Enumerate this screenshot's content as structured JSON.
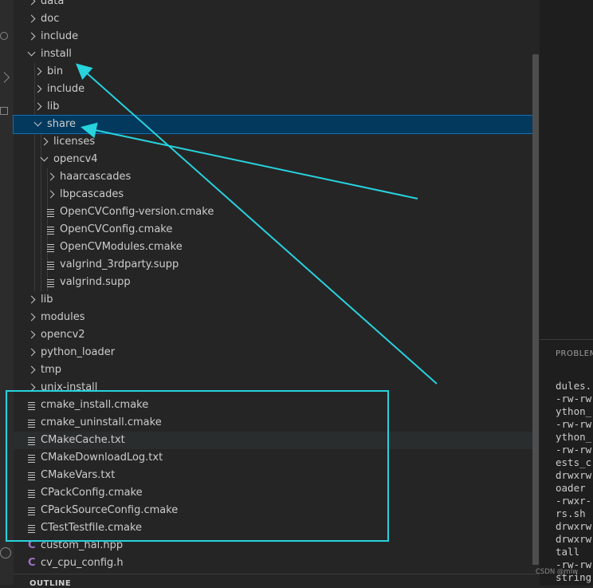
{
  "explorer": {
    "rows": [
      {
        "label": "data",
        "icon": "chevron-right"
      },
      {
        "label": "doc",
        "icon": "chevron-right"
      },
      {
        "label": "include",
        "icon": "chevron-right"
      },
      {
        "label": "install",
        "icon": "chevron-down"
      },
      {
        "label": "bin",
        "icon": "chevron-right"
      },
      {
        "label": "include",
        "icon": "chevron-right"
      },
      {
        "label": "lib",
        "icon": "chevron-right"
      },
      {
        "label": "share",
        "icon": "chevron-down"
      },
      {
        "label": "licenses",
        "icon": "chevron-right"
      },
      {
        "label": "opencv4",
        "icon": "chevron-down"
      },
      {
        "label": "haarcascades",
        "icon": "chevron-right"
      },
      {
        "label": "lbpcascades",
        "icon": "chevron-right"
      },
      {
        "label": "OpenCVConfig-version.cmake",
        "icon": "file-lines"
      },
      {
        "label": "OpenCVConfig.cmake",
        "icon": "file-lines"
      },
      {
        "label": "OpenCVModules.cmake",
        "icon": "file-lines"
      },
      {
        "label": "valgrind_3rdparty.supp",
        "icon": "file-lines"
      },
      {
        "label": "valgrind.supp",
        "icon": "file-lines"
      },
      {
        "label": "lib",
        "icon": "chevron-right"
      },
      {
        "label": "modules",
        "icon": "chevron-right"
      },
      {
        "label": "opencv2",
        "icon": "chevron-right"
      },
      {
        "label": "python_loader",
        "icon": "chevron-right"
      },
      {
        "label": "tmp",
        "icon": "chevron-right"
      },
      {
        "label": "unix-install",
        "icon": "chevron-right"
      },
      {
        "label": "cmake_install.cmake",
        "icon": "file-lines"
      },
      {
        "label": "cmake_uninstall.cmake",
        "icon": "file-lines"
      },
      {
        "label": "CMakeCache.txt",
        "icon": "file-lines"
      },
      {
        "label": "CMakeDownloadLog.txt",
        "icon": "file-lines"
      },
      {
        "label": "CMakeVars.txt",
        "icon": "file-lines"
      },
      {
        "label": "CPackConfig.cmake",
        "icon": "file-lines"
      },
      {
        "label": "CPackSourceConfig.cmake",
        "icon": "file-lines"
      },
      {
        "label": "CTestTestfile.cmake",
        "icon": "file-lines"
      },
      {
        "label": "custom_hal.hpp",
        "icon": "c-file"
      },
      {
        "label": "cv_cpu_config.h",
        "icon": "c-file"
      }
    ],
    "selected_label": "share",
    "c_icon_glyph": "C"
  },
  "outline": {
    "title": "OUTLINE"
  },
  "panel": {
    "title": "PROBLEM",
    "terminal_lines": [
      "dules.",
      "-rw-rw",
      "ython_",
      "-rw-rw",
      "ython_",
      "-rw-rw",
      "ests_c",
      "drwxrw",
      "oader",
      "-rwxr-",
      "rs.sh",
      "drwxrw",
      "drwxrw",
      "tall",
      "-rw-rw",
      "string"
    ]
  },
  "watermark": "CSDN @mlw",
  "colors": {
    "accent": "#27d3dd",
    "selection": "#04395e",
    "c_icon": "#a074c4"
  }
}
